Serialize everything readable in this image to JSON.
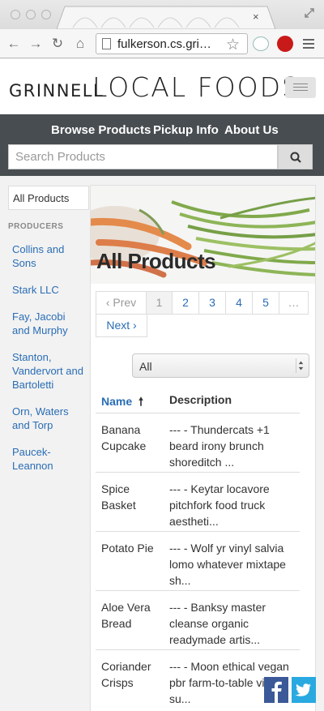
{
  "browser": {
    "url_text": "fulkerson.cs.gri…",
    "close_glyph": "×"
  },
  "brand": {
    "left_text": "GRINNELL",
    "right_text": "LOCAL FOODS"
  },
  "nav": {
    "links": [
      "Browse Products",
      "Pickup Info",
      "About Us"
    ],
    "search_placeholder": "Search Products"
  },
  "sidebar": {
    "select_value": "All Products",
    "heading": "PRODUCERS",
    "producers": [
      "Collins and Sons",
      "Stark LLC",
      "Fay, Jacobi and Murphy",
      "Stanton, Vandervort and Bartoletti",
      "Orn, Waters and Torp",
      "Paucek-Leannon"
    ]
  },
  "main": {
    "title": "All Products",
    "pagination": {
      "prev": "‹ Prev",
      "pages": [
        "1",
        "2",
        "3",
        "4",
        "5",
        "…"
      ],
      "active": "1",
      "next": "Next ›"
    },
    "filter_value": "All",
    "table": {
      "headers": [
        "Name",
        "Description"
      ],
      "sort_indicator": "🠕",
      "rows": [
        {
          "name": "Banana Cupcake",
          "desc": "--- - Thundercats +1 beard irony brunch shoreditch ..."
        },
        {
          "name": "Spice Basket",
          "desc": "--- - Keytar locavore pitchfork food truck aestheti..."
        },
        {
          "name": "Potato Pie",
          "desc": "--- - Wolf yr vinyl salvia lomo whatever mixtape sh..."
        },
        {
          "name": "Aloe Vera Bread",
          "desc": "--- - Banksy master cleanse organic readymade artis..."
        },
        {
          "name": "Coriander Crisps",
          "desc": "--- - Moon ethical vegan pbr farm-to-table viral su..."
        }
      ]
    }
  },
  "colors": {
    "link": "#2a6db5",
    "navbar": "#484d51",
    "facebook": "#3b5998",
    "twitter": "#29a9e0"
  }
}
